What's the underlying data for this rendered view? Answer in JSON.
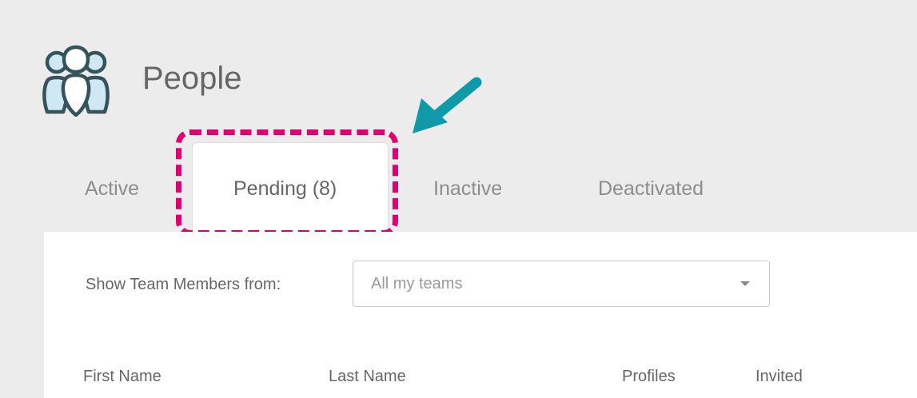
{
  "header": {
    "title": "People",
    "icon": "people-group-icon"
  },
  "tabs": [
    {
      "label": "Active"
    },
    {
      "label": "Pending (8)",
      "active": true
    },
    {
      "label": "Inactive"
    },
    {
      "label": "Deactivated"
    }
  ],
  "annotation": {
    "highlight_color": "#e0006f",
    "arrow_color": "#0f9aaa",
    "arrow_icon": "arrow-down-left-icon"
  },
  "filter": {
    "label": "Show Team Members from:",
    "selected": "All my teams"
  },
  "table": {
    "columns": [
      "First Name",
      "Last Name",
      "Profiles",
      "Invited"
    ]
  }
}
